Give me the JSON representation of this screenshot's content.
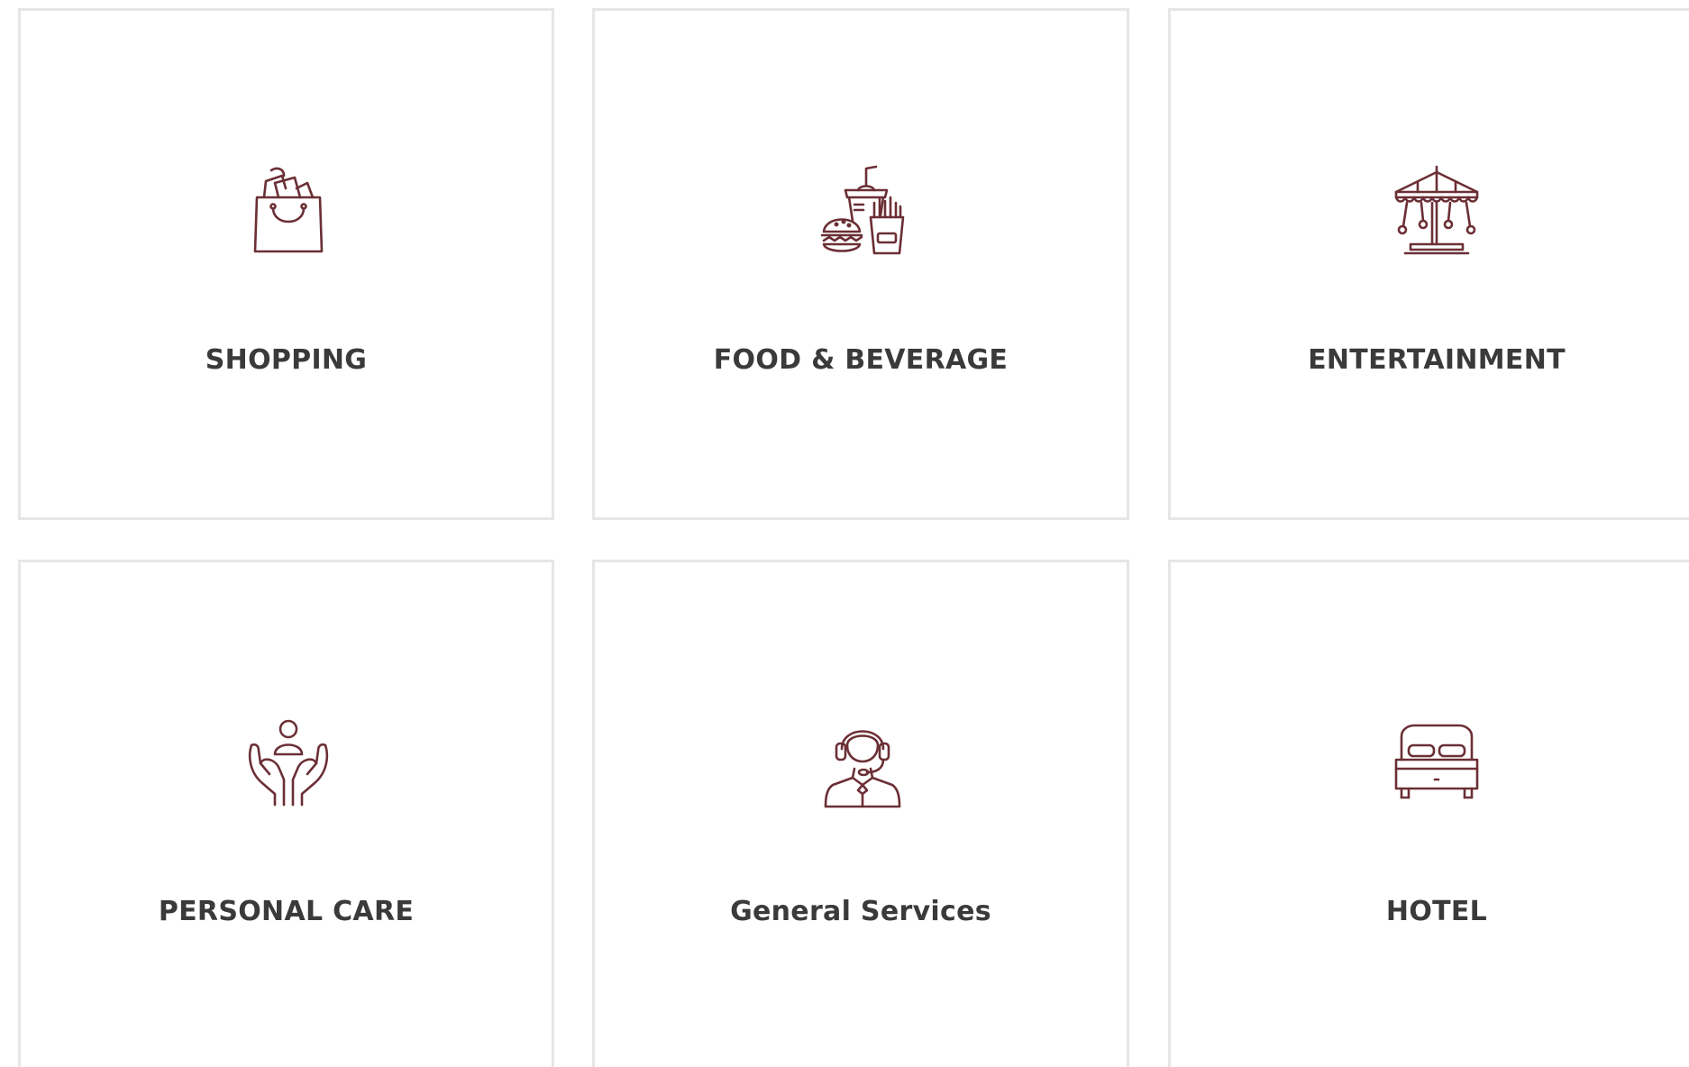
{
  "theme": {
    "icon_color": "#6b2f35",
    "label_color": "#3a3a3a",
    "card_border_color": "#e6e6e6"
  },
  "categories": [
    {
      "label": "SHOPPING",
      "icon": "shopping-bag-icon"
    },
    {
      "label": "FOOD & BEVERAGE",
      "icon": "fast-food-icon"
    },
    {
      "label": "ENTERTAINMENT",
      "icon": "carousel-icon"
    },
    {
      "label": "PERSONAL CARE",
      "icon": "care-hands-icon"
    },
    {
      "label": "General Services",
      "icon": "customer-support-icon"
    },
    {
      "label": "HOTEL",
      "icon": "bed-icon"
    }
  ]
}
